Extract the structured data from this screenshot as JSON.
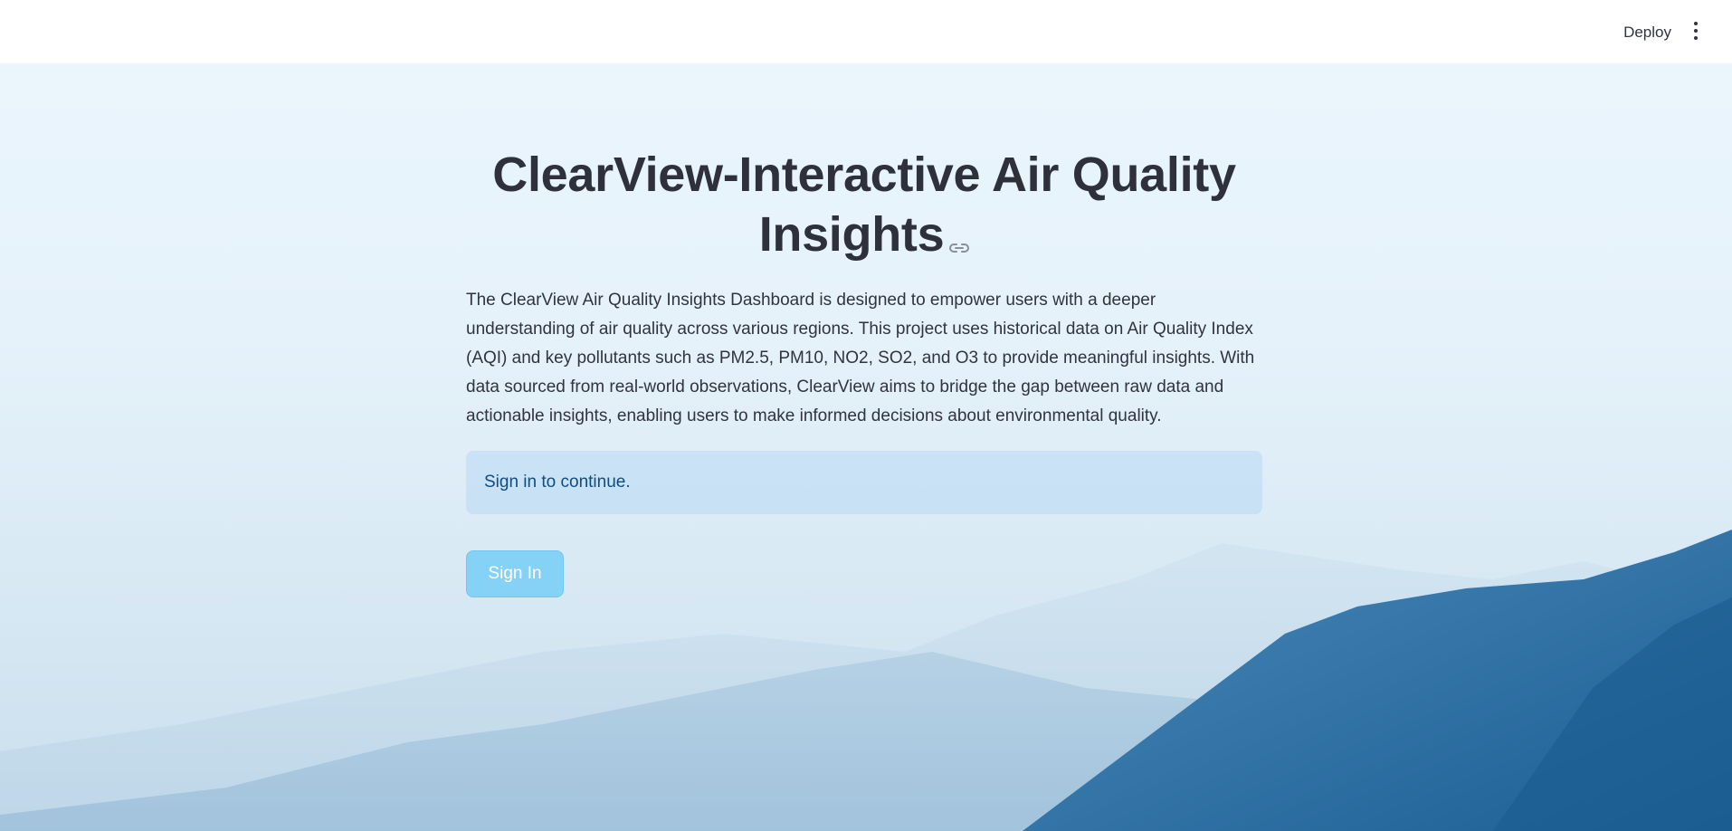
{
  "header": {
    "deploy_label": "Deploy",
    "menu_icon": "more-vertical-icon"
  },
  "main": {
    "title": "ClearView-Interactive Air Quality Insights",
    "anchor_icon": "link-icon",
    "description": "The ClearView Air Quality Insights Dashboard is designed to empower users with a deeper understanding of air quality across various regions. This project uses historical data on Air Quality Index (AQI) and key pollutants such as PM2.5, PM10, NO2, SO2, and O3 to provide meaningful insights. With data sourced from real-world observations, ClearView aims to bridge the gap between raw data and actionable insights, enabling users to make informed decisions about environmental quality.",
    "info_message": "Sign in to continue.",
    "signin_label": "Sign In"
  },
  "colors": {
    "info_text": "#0f4c81",
    "button_bg": "#86d2f6",
    "title_text": "#2e313b"
  }
}
